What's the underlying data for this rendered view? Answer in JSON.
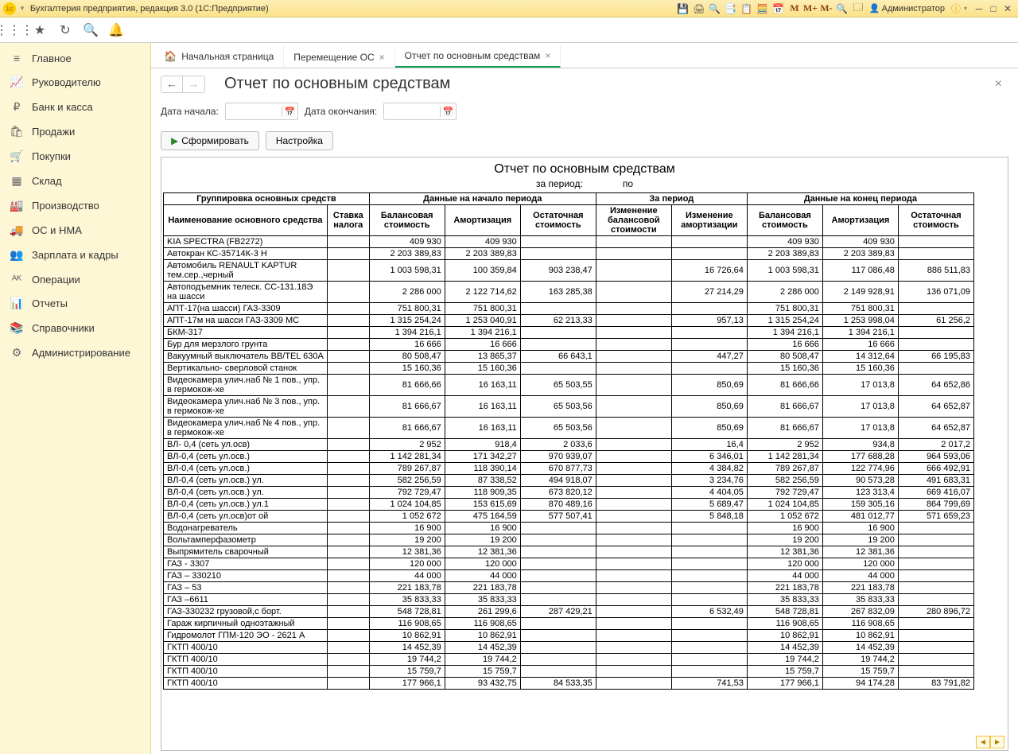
{
  "app_title": "Бухгалтерия предприятия, редакция 3.0  (1С:Предприятие)",
  "user": "Администратор",
  "tb_m": [
    "M",
    "M+",
    "M-"
  ],
  "sidebar": {
    "items": [
      {
        "icon": "≡",
        "label": "Главное"
      },
      {
        "icon": "📈",
        "label": "Руководителю"
      },
      {
        "icon": "₽",
        "label": "Банк и касса"
      },
      {
        "icon": "🛍",
        "label": "Продажи"
      },
      {
        "icon": "🛒",
        "label": "Покупки"
      },
      {
        "icon": "▦",
        "label": "Склад"
      },
      {
        "icon": "🏭",
        "label": "Производство"
      },
      {
        "icon": "🚚",
        "label": "ОС и НМА"
      },
      {
        "icon": "👥",
        "label": "Зарплата и кадры"
      },
      {
        "icon": "ᴬᴷ",
        "label": "Операции"
      },
      {
        "icon": "📊",
        "label": "Отчеты"
      },
      {
        "icon": "📚",
        "label": "Справочники"
      },
      {
        "icon": "⚙",
        "label": "Администрирование"
      }
    ]
  },
  "tabs": [
    {
      "label": "Начальная страница",
      "home": true
    },
    {
      "label": "Перемещение ОС",
      "close": true
    },
    {
      "label": "Отчет по основным средствам",
      "close": true,
      "active": true
    }
  ],
  "page": {
    "title": "Отчет по основным средствам",
    "date_start_label": "Дата начала:",
    "date_end_label": "Дата окончания:",
    "btn_form": "Сформировать",
    "btn_settings": "Настройка"
  },
  "report": {
    "title": "Отчет по основным средствам",
    "period_prefix": "за период:",
    "period_mid": " по ",
    "h_group": "Группировка основных средств",
    "h_start": "Данные на начало периода",
    "h_period": "За период",
    "h_end": "Данные на конец периода",
    "h_name": "Наименование основного средства",
    "h_tax": "Ставка налога",
    "h_bal": "Балансовая стоимость",
    "h_amort": "Амортизация",
    "h_resid": "Остаточная стоимость",
    "h_chg_bal": "Изменение балансовой стоимости",
    "h_chg_am": "Изменение амортизации",
    "rows": [
      {
        "n": "KIA SPECTRA (FB2272)",
        "sb": "409 930",
        "sa": "409 930",
        "sr": "",
        "cb": "",
        "ca": "",
        "eb": "409 930",
        "ea": "409 930",
        "er": ""
      },
      {
        "n": "Автокран КС-35714К-3  Н",
        "sb": "2 203 389,83",
        "sa": "2 203 389,83",
        "sr": "",
        "cb": "",
        "ca": "",
        "eb": "2 203 389,83",
        "ea": "2 203 389,83",
        "er": ""
      },
      {
        "n": "Автомобиль RENAULT KAPTUR тем.сер.,черный",
        "sb": "1 003 598,31",
        "sa": "100 359,84",
        "sr": "903 238,47",
        "cb": "",
        "ca": "16 726,64",
        "eb": "1 003 598,31",
        "ea": "117 086,48",
        "er": "886 511,83"
      },
      {
        "n": "Автоподъемник телеск. СС-131.18Э на шасси",
        "sb": "2 286 000",
        "sa": "2 122 714,62",
        "sr": "163 285,38",
        "cb": "",
        "ca": "27 214,29",
        "eb": "2 286 000",
        "ea": "2 149 928,91",
        "er": "136 071,09"
      },
      {
        "n": "АПТ-17(на шасси) ГАЗ-3309",
        "sb": "751 800,31",
        "sa": "751 800,31",
        "sr": "",
        "cb": "",
        "ca": "",
        "eb": "751 800,31",
        "ea": "751 800,31",
        "er": ""
      },
      {
        "n": "АПТ-17м на шасси ГАЗ-3309         МС",
        "sb": "1 315 254,24",
        "sa": "1 253 040,91",
        "sr": "62 213,33",
        "cb": "",
        "ca": "957,13",
        "eb": "1 315 254,24",
        "ea": "1 253 998,04",
        "er": "61 256,2"
      },
      {
        "n": "БКМ-317",
        "sb": "1 394 216,1",
        "sa": "1 394 216,1",
        "sr": "",
        "cb": "",
        "ca": "",
        "eb": "1 394 216,1",
        "ea": "1 394 216,1",
        "er": ""
      },
      {
        "n": "Бур для мерзлого грунта",
        "sb": "16 666",
        "sa": "16 666",
        "sr": "",
        "cb": "",
        "ca": "",
        "eb": "16 666",
        "ea": "16 666",
        "er": ""
      },
      {
        "n": "Вакуумный выключатель BB/TEL 630А",
        "sb": "80 508,47",
        "sa": "13 865,37",
        "sr": "66 643,1",
        "cb": "",
        "ca": "447,27",
        "eb": "80 508,47",
        "ea": "14 312,64",
        "er": "66 195,83"
      },
      {
        "n": "Вертикально- сверловой станок",
        "sb": "15 160,36",
        "sa": "15 160,36",
        "sr": "",
        "cb": "",
        "ca": "",
        "eb": "15 160,36",
        "ea": "15 160,36",
        "er": ""
      },
      {
        "n": "Видеокамера улич.наб № 1 пов., упр. в гермокож-хе",
        "sb": "81 666,66",
        "sa": "16 163,11",
        "sr": "65 503,55",
        "cb": "",
        "ca": "850,69",
        "eb": "81 666,66",
        "ea": "17 013,8",
        "er": "64 652,86"
      },
      {
        "n": "Видеокамера улич.наб № 3 пов., упр. в гермокож-хе",
        "sb": "81 666,67",
        "sa": "16 163,11",
        "sr": "65 503,56",
        "cb": "",
        "ca": "850,69",
        "eb": "81 666,67",
        "ea": "17 013,8",
        "er": "64 652,87"
      },
      {
        "n": "Видеокамера улич.наб № 4 пов., упр. в гермокож-хе",
        "sb": "81 666,67",
        "sa": "16 163,11",
        "sr": "65 503,56",
        "cb": "",
        "ca": "850,69",
        "eb": "81 666,67",
        "ea": "17 013,8",
        "er": "64 652,87"
      },
      {
        "n": "ВЛ- 0,4 (сеть ул.осв)",
        "sb": "2 952",
        "sa": "918,4",
        "sr": "2 033,6",
        "cb": "",
        "ca": "16,4",
        "eb": "2 952",
        "ea": "934,8",
        "er": "2 017,2"
      },
      {
        "n": "ВЛ-0,4 (сеть ул.осв.)",
        "sb": "1 142 281,34",
        "sa": "171 342,27",
        "sr": "970 939,07",
        "cb": "",
        "ca": "6 346,01",
        "eb": "1 142 281,34",
        "ea": "177 688,28",
        "er": "964 593,06"
      },
      {
        "n": "ВЛ-0,4 (сеть ул.осв.)",
        "sb": "789 267,87",
        "sa": "118 390,14",
        "sr": "670 877,73",
        "cb": "",
        "ca": "4 384,82",
        "eb": "789 267,87",
        "ea": "122 774,96",
        "er": "666 492,91"
      },
      {
        "n": "ВЛ-0,4 (сеть ул.осв.) ул.",
        "sb": "582 256,59",
        "sa": "87 338,52",
        "sr": "494 918,07",
        "cb": "",
        "ca": "3 234,76",
        "eb": "582 256,59",
        "ea": "90 573,28",
        "er": "491 683,31"
      },
      {
        "n": "ВЛ-0,4 (сеть ул.осв.) ул.",
        "sb": "792 729,47",
        "sa": "118 909,35",
        "sr": "673 820,12",
        "cb": "",
        "ca": "4 404,05",
        "eb": "792 729,47",
        "ea": "123 313,4",
        "er": "669 416,07"
      },
      {
        "n": "ВЛ-0,4 (сеть ул.осв.) ул.1",
        "sb": "1 024 104,85",
        "sa": "153 615,69",
        "sr": "870 489,16",
        "cb": "",
        "ca": "5 689,47",
        "eb": "1 024 104,85",
        "ea": "159 305,16",
        "er": "864 799,69"
      },
      {
        "n": "ВЛ-0,4 (сеть ул.осв)от               ой",
        "sb": "1 052 672",
        "sa": "475 164,59",
        "sr": "577 507,41",
        "cb": "",
        "ca": "5 848,18",
        "eb": "1 052 672",
        "ea": "481 012,77",
        "er": "571 659,23"
      },
      {
        "n": "Водонагреватель",
        "sb": "16 900",
        "sa": "16 900",
        "sr": "",
        "cb": "",
        "ca": "",
        "eb": "16 900",
        "ea": "16 900",
        "er": ""
      },
      {
        "n": "Вольтамперфазометр",
        "sb": "19 200",
        "sa": "19 200",
        "sr": "",
        "cb": "",
        "ca": "",
        "eb": "19 200",
        "ea": "19 200",
        "er": ""
      },
      {
        "n": "Выпрямитель сварочный",
        "sb": "12 381,36",
        "sa": "12 381,36",
        "sr": "",
        "cb": "",
        "ca": "",
        "eb": "12 381,36",
        "ea": "12 381,36",
        "er": ""
      },
      {
        "n": "ГАЗ - 3307",
        "sb": "120 000",
        "sa": "120 000",
        "sr": "",
        "cb": "",
        "ca": "",
        "eb": "120 000",
        "ea": "120 000",
        "er": ""
      },
      {
        "n": "ГАЗ – 330210",
        "sb": "44 000",
        "sa": "44 000",
        "sr": "",
        "cb": "",
        "ca": "",
        "eb": "44 000",
        "ea": "44 000",
        "er": ""
      },
      {
        "n": "ГАЗ – 53",
        "sb": "221 183,78",
        "sa": "221 183,78",
        "sr": "",
        "cb": "",
        "ca": "",
        "eb": "221 183,78",
        "ea": "221 183,78",
        "er": ""
      },
      {
        "n": "ГАЗ –6611",
        "sb": "35 833,33",
        "sa": "35 833,33",
        "sr": "",
        "cb": "",
        "ca": "",
        "eb": "35 833,33",
        "ea": "35 833,33",
        "er": ""
      },
      {
        "n": "ГАЗ-330232  грузовой,с борт.",
        "sb": "548 728,81",
        "sa": "261 299,6",
        "sr": "287 429,21",
        "cb": "",
        "ca": "6 532,49",
        "eb": "548 728,81",
        "ea": "267 832,09",
        "er": "280 896,72"
      },
      {
        "n": "Гараж кирпичный одноэтажный",
        "sb": "116 908,65",
        "sa": "116 908,65",
        "sr": "",
        "cb": "",
        "ca": "",
        "eb": "116 908,65",
        "ea": "116 908,65",
        "er": ""
      },
      {
        "n": "Гидромолот ГПМ-120            ЭО - 2621 А",
        "sb": "10 862,91",
        "sa": "10 862,91",
        "sr": "",
        "cb": "",
        "ca": "",
        "eb": "10 862,91",
        "ea": "10 862,91",
        "er": ""
      },
      {
        "n": "ГКТП 400/10",
        "sb": "14 452,39",
        "sa": "14 452,39",
        "sr": "",
        "cb": "",
        "ca": "",
        "eb": "14 452,39",
        "ea": "14 452,39",
        "er": ""
      },
      {
        "n": "ГКТП 400/10",
        "sb": "19 744,2",
        "sa": "19 744,2",
        "sr": "",
        "cb": "",
        "ca": "",
        "eb": "19 744,2",
        "ea": "19 744,2",
        "er": ""
      },
      {
        "n": "ГКТП 400/10",
        "sb": "15 759,7",
        "sa": "15 759,7",
        "sr": "",
        "cb": "",
        "ca": "",
        "eb": "15 759,7",
        "ea": "15 759,7",
        "er": ""
      },
      {
        "n": "ГКТП 400/10",
        "sb": "177 966,1",
        "sa": "93 432,75",
        "sr": "84 533,35",
        "cb": "",
        "ca": "741,53",
        "eb": "177 966,1",
        "ea": "94 174,28",
        "er": "83 791,82"
      }
    ]
  }
}
